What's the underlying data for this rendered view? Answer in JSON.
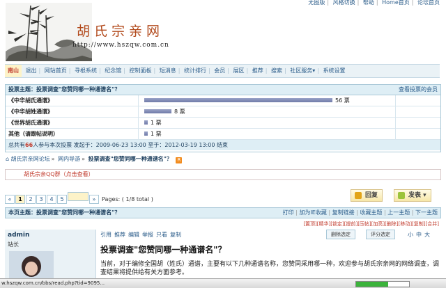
{
  "toplinks": [
    "无图版",
    "风格切换",
    "帮助",
    "Home首页",
    "论坛首页"
  ],
  "header": {
    "site_title": "胡氏宗亲网",
    "url": "http://www.hszqw.com.cn"
  },
  "nav": {
    "user": "南山",
    "items": [
      "退出",
      "网站首页",
      "寻根系统",
      "纪念馆",
      "控制面板",
      "短消息",
      "统计排行",
      "会员",
      "展区",
      "推荐",
      "搜索",
      "社区服务",
      "系统设置"
    ],
    "service_arrow": "▾"
  },
  "poll": {
    "subject_label": "投票主题：投票调查\"您赞同哪一种通谱名\"？",
    "view_voters": "查看投票的会员",
    "options": [
      {
        "label": "《中华胡氏通谱》",
        "votes": 56,
        "count_text": "56 票"
      },
      {
        "label": "《中华胡姓通谱》",
        "votes": 8,
        "count_text": "8 票"
      },
      {
        "label": "《世界胡氏通谱》",
        "votes": 1,
        "count_text": "1 票"
      },
      {
        "label": "其他（请跟帖说明）",
        "votes": 1,
        "count_text": "1 票"
      }
    ],
    "max_votes": 56,
    "footer": {
      "pre": "总共有",
      "count": "66",
      "post": "人参与本次投票 发起于：2009-06-23 13:00   至于：2012-03-19 13:00 结束"
    }
  },
  "breadcrumb": {
    "items": [
      "胡氏宗亲网论坛",
      "网内导游",
      "投票调查\"您赞同哪一种通谱名\"？"
    ],
    "separator": "»",
    "rss_label": "R"
  },
  "qq_text": "胡氏宗亲QQ群（点击查看）",
  "pagination": {
    "first": "«",
    "pages": [
      "1",
      "2",
      "3",
      "4",
      "5"
    ],
    "current": "1",
    "last": "»",
    "info": "Pages: ( 1/8 total )"
  },
  "buttons": {
    "reply": "回复",
    "post": "发表",
    "post_arrow": "▾"
  },
  "post_head": {
    "title": "本页主题：投票调查\"您赞同哪一种通谱名\"？",
    "tools": [
      "打印",
      "加为IE收藏",
      "复制链接",
      "收藏主题",
      "上一主题",
      "下一主题"
    ]
  },
  "moderation": [
    "[置顶]",
    "[精华]",
    "[锁定]",
    "[提前]",
    "[压帖]",
    "[加亮]",
    "[删除]",
    "[移动]",
    "[复制]",
    "[合并]"
  ],
  "author": {
    "name": "admin",
    "role": "站长"
  },
  "post_ops": [
    "引用",
    "推荐",
    "编辑",
    "举报",
    "只看",
    "复制"
  ],
  "op_buttons": {
    "delete": "删除选定",
    "rate": "评分选定"
  },
  "font_sizes": [
    "小",
    "中",
    "大"
  ],
  "post": {
    "title": "投票调查\"您赞同哪一种通谱名\"？",
    "body": "当前，对于编修全国胡（姓氏）通谱，主要有以下几种通谱名称，您赞同采用哪一种，欢迎参与胡氏宗亲网的网络调查，调查结果将提供给有关方面参考。"
  },
  "statusbar": {
    "url": "w.hszqw.com.cn/bbs/read.php?tid=9095...",
    "progress": 0.6
  },
  "colors": {
    "accent": "#2b5c8a",
    "header_bg": "#deeef5",
    "highlight": "#c0392b"
  }
}
